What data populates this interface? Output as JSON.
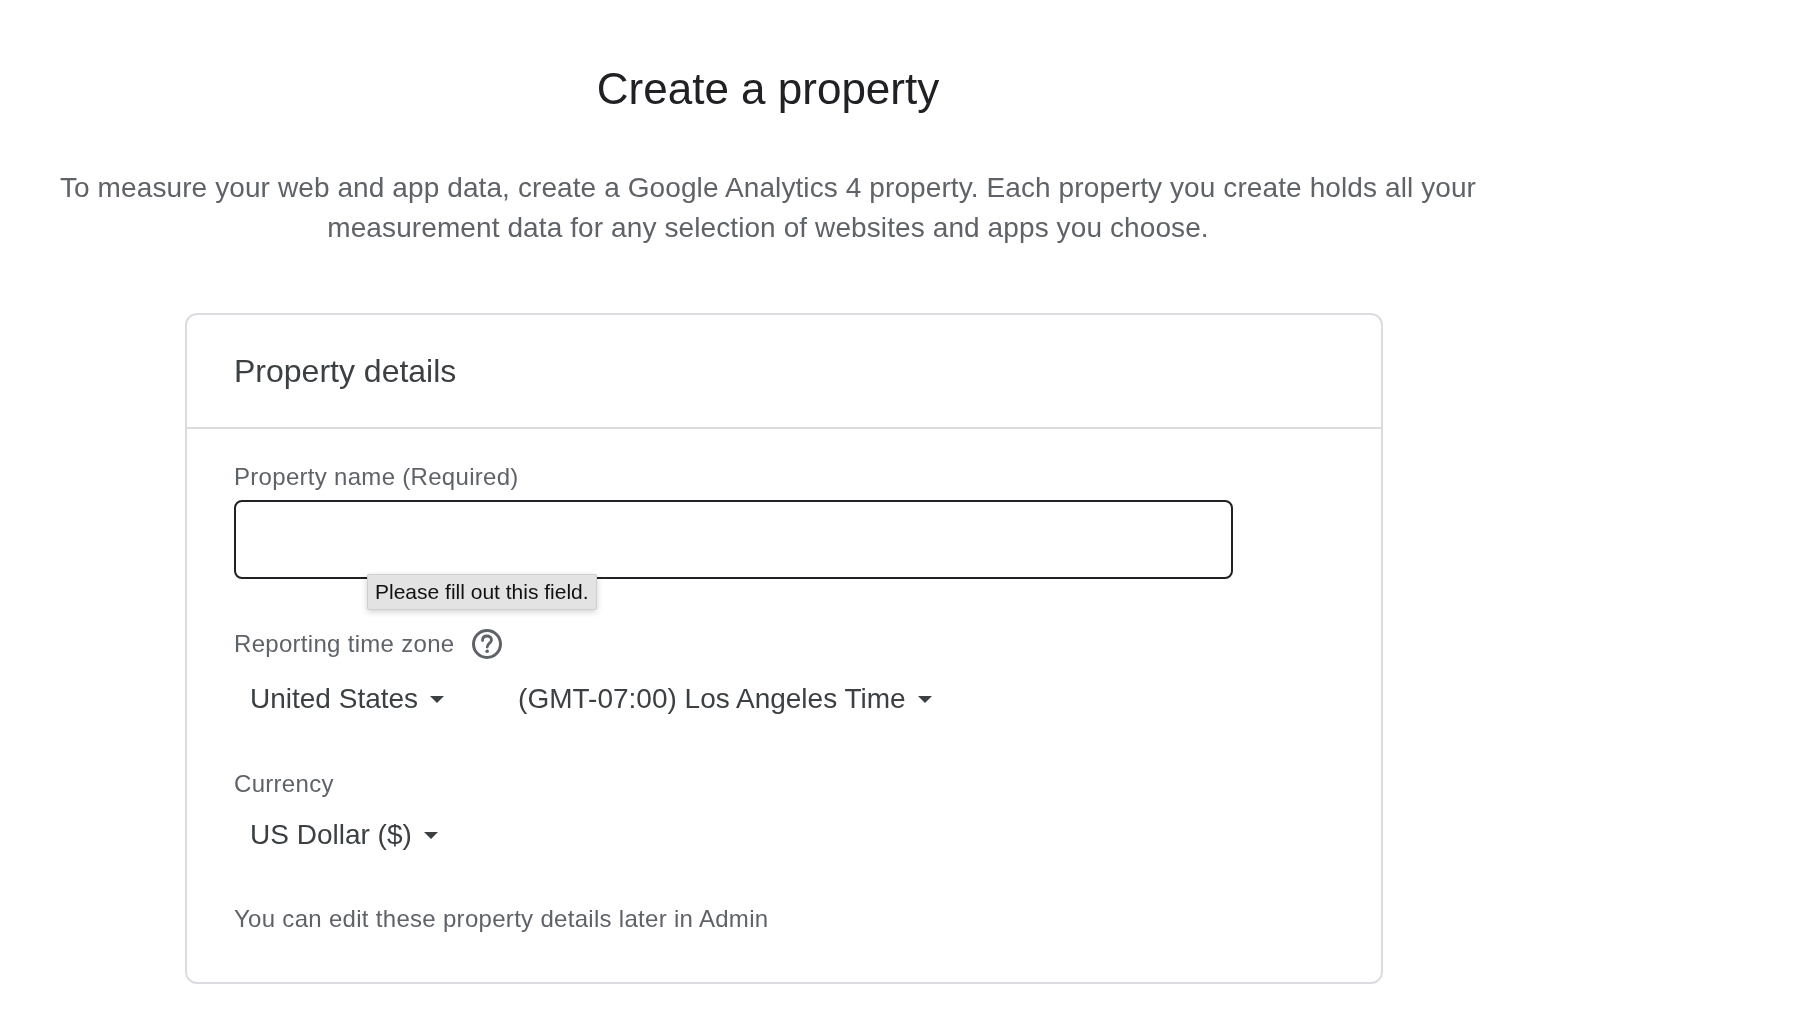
{
  "page": {
    "title": "Create a property",
    "description": "To measure your web and app data, create a Google Analytics 4 property. Each property you create holds all your measurement data for any selection of websites and apps you choose."
  },
  "card": {
    "title": "Property details",
    "property_name": {
      "label": "Property name (Required)",
      "tooltip": "Please fill out this field."
    },
    "time_zone": {
      "label": "Reporting time zone",
      "dropdowns": [
        "United States",
        "(GMT-07:00) Los Angeles Time"
      ]
    },
    "currency": {
      "label": "Currency",
      "dropdowns": [
        "US Dollar ($)"
      ]
    },
    "note": "You can edit these property details later in Admin"
  }
}
